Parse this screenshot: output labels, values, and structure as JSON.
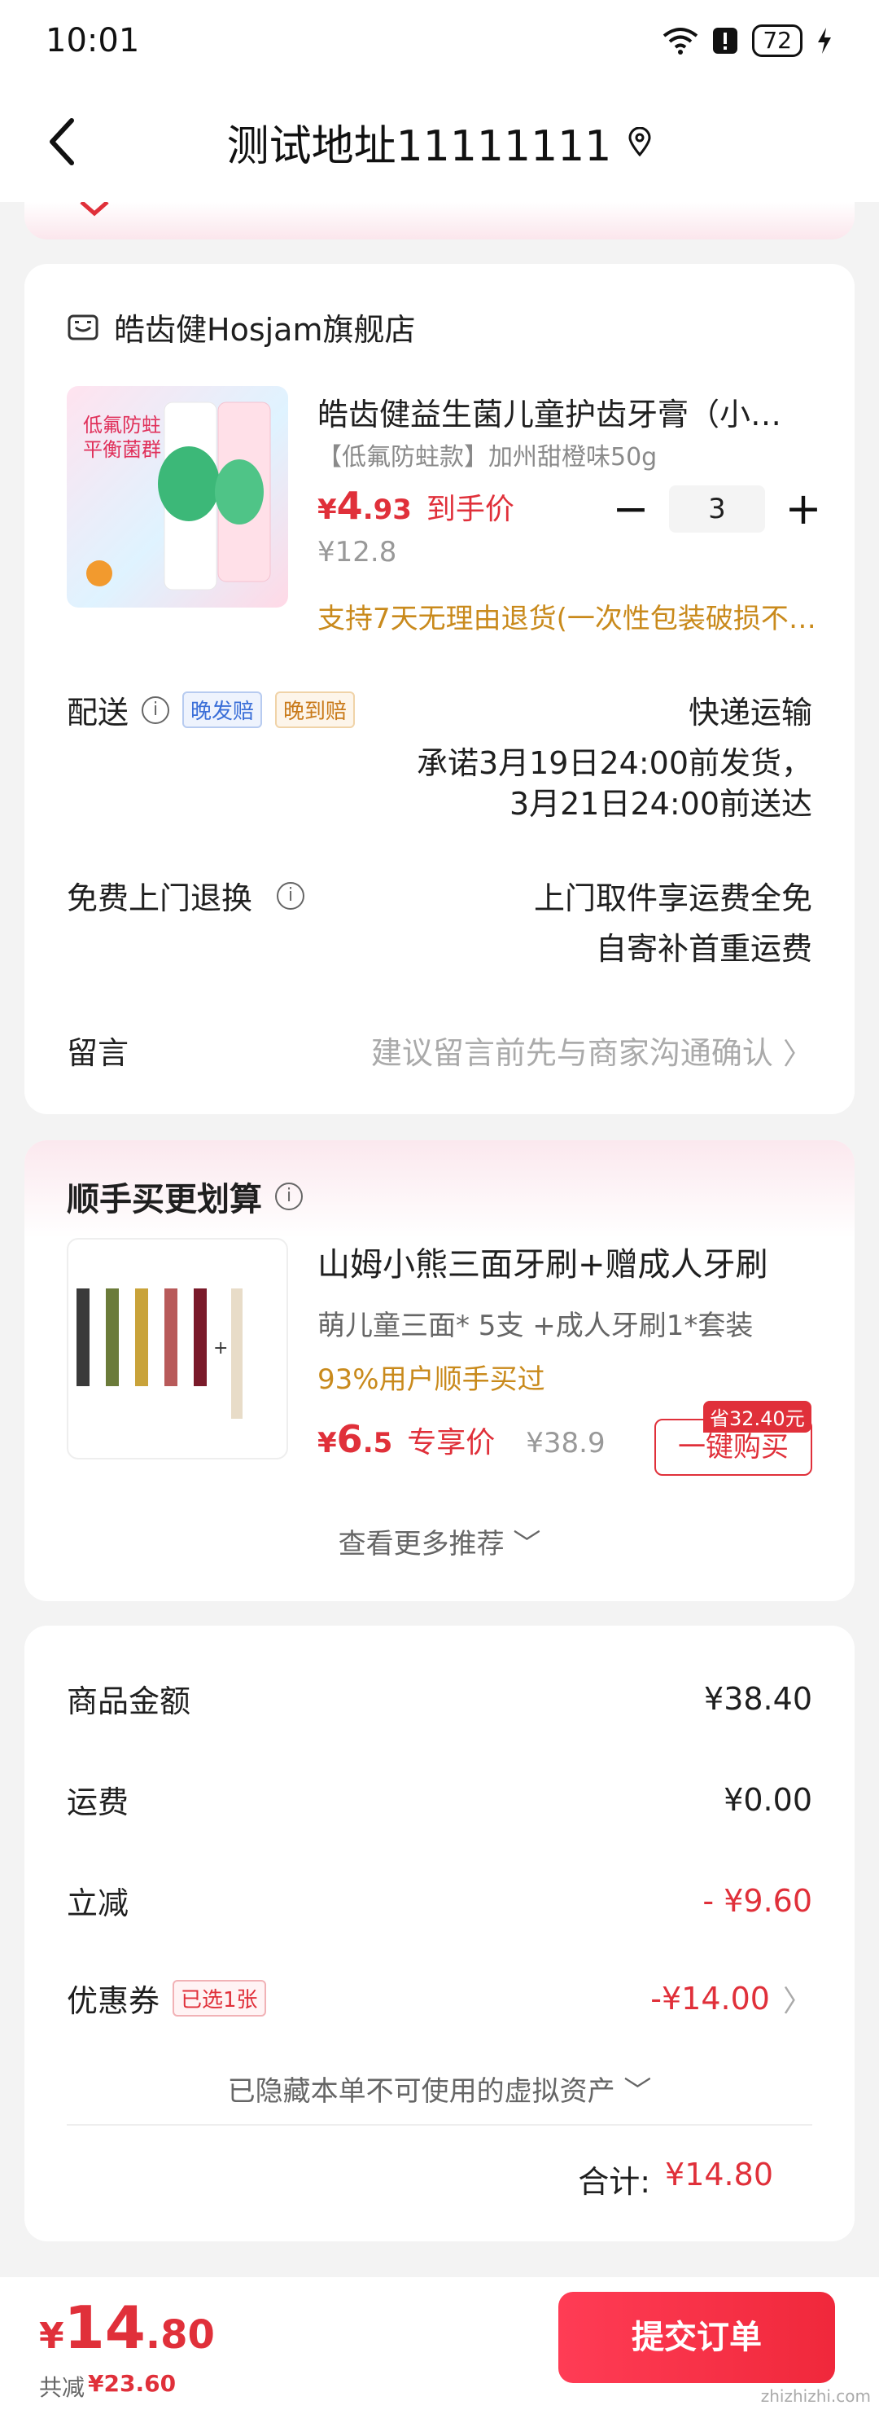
{
  "status": {
    "time": "10:01",
    "battery": "72"
  },
  "nav": {
    "title": "测试地址11111111"
  },
  "shop": {
    "name": "皓齿健Hosjam旗舰店"
  },
  "product": {
    "title": "皓齿健益生菌儿童护齿牙膏（小…",
    "spec": "【低氟防蛀款】加州甜橙味50g",
    "price_symbol": "¥",
    "price_int": "4",
    "price_dec": ".93",
    "price_tag": "到手价",
    "orig_price": "¥12.8",
    "quantity": "3",
    "refund_note": "支持7天无理由退货(一次性包装破损不…"
  },
  "delivery": {
    "label": "配送",
    "badge_late": "晚发赔",
    "badge_arrive": "晚到赔",
    "method": "快递运输",
    "line1": "承诺3月19日24:00前发货，",
    "line2": "3月21日24:00前送达"
  },
  "return_service": {
    "label": "免费上门退换",
    "line1": "上门取件享运费全免",
    "line2": "自寄补首重运费"
  },
  "message": {
    "label": "留言",
    "placeholder": "建议留言前先与商家沟通确认"
  },
  "bundle": {
    "title": "顺手买更划算",
    "name": "山姆小熊三面牙刷+赠成人牙刷",
    "desc": "萌儿童三面* 5支 +成人牙刷1*套装",
    "stat": "93%用户顺手买过",
    "price_symbol": "¥",
    "price_int": "6",
    "price_dec": ".5",
    "price_tag": "专享价",
    "orig_price": "¥38.9",
    "save_tag": "省32.40元",
    "buy_label": "一键购买",
    "more": "查看更多推荐"
  },
  "summary": {
    "goods_label": "商品金额",
    "goods_value": "¥38.40",
    "shipping_label": "运费",
    "shipping_value": "¥0.00",
    "discount_label": "立减",
    "discount_value": "- ¥9.60",
    "coupon_label": "优惠券",
    "coupon_badge": "已选1张",
    "coupon_value": "-¥14.00",
    "hidden_note": "已隐藏本单不可使用的虚拟资产",
    "total_label": "合计:",
    "total_value": "¥14.80"
  },
  "footer": {
    "price_symbol": "¥",
    "price_int": "14",
    "price_dec": ".80",
    "saved_label": "共减",
    "saved_value": "¥23.60",
    "submit_label": "提交订单",
    "watermark": "zhizhizhi.com"
  },
  "colors": {
    "accent": "#e0303a",
    "warning": "#c98a1c"
  }
}
